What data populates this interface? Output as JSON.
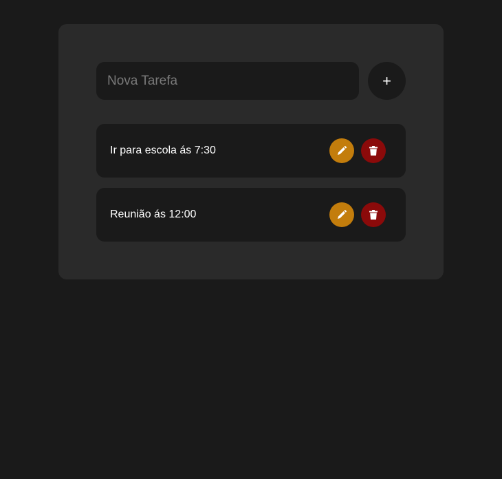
{
  "new_task": {
    "placeholder": "Nova Tarefa",
    "value": "",
    "add_label": "+"
  },
  "tasks": [
    {
      "text": "Ir para escola ás 7:30",
      "edit_icon": "pencil-icon",
      "delete_icon": "trash-icon"
    },
    {
      "text": "Reunião ás 12:00",
      "edit_icon": "pencil-icon",
      "delete_icon": "trash-icon"
    }
  ],
  "colors": {
    "background": "#1a1a1a",
    "card": "#2a2a2a",
    "edit": "#c37d0c",
    "delete": "#8b0a0a"
  }
}
